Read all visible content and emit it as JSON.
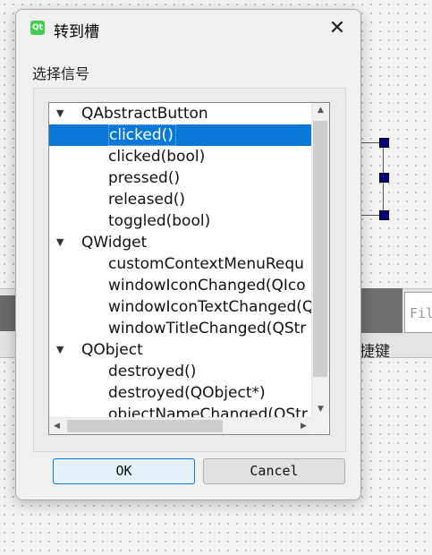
{
  "dialog": {
    "title": "转到槽",
    "close_glyph": "✕",
    "app_icon_text": "Qt",
    "signal_label": "选择信号",
    "ok_label": "OK",
    "cancel_label": "Cancel"
  },
  "background": {
    "field_text": "Fil",
    "shortcut_text": "捷键"
  },
  "tree": {
    "groups": [
      {
        "name": "QAbstractButton",
        "expanded": true,
        "items": [
          "clicked()",
          "clicked(bool)",
          "pressed()",
          "released()",
          "toggled(bool)"
        ]
      },
      {
        "name": "QWidget",
        "expanded": true,
        "items": [
          "customContextMenuRequ",
          "windowIconChanged(QIco",
          "windowIconTextChanged(Q",
          "windowTitleChanged(QStr"
        ]
      },
      {
        "name": "QObject",
        "expanded": true,
        "items": [
          "destroyed()",
          "destroyed(QObject*)",
          "objectNameChanged(QStr"
        ]
      }
    ],
    "selected": "clicked()",
    "colors": {
      "selection": "#0b78d7",
      "ok_border": "#0078d7"
    }
  }
}
